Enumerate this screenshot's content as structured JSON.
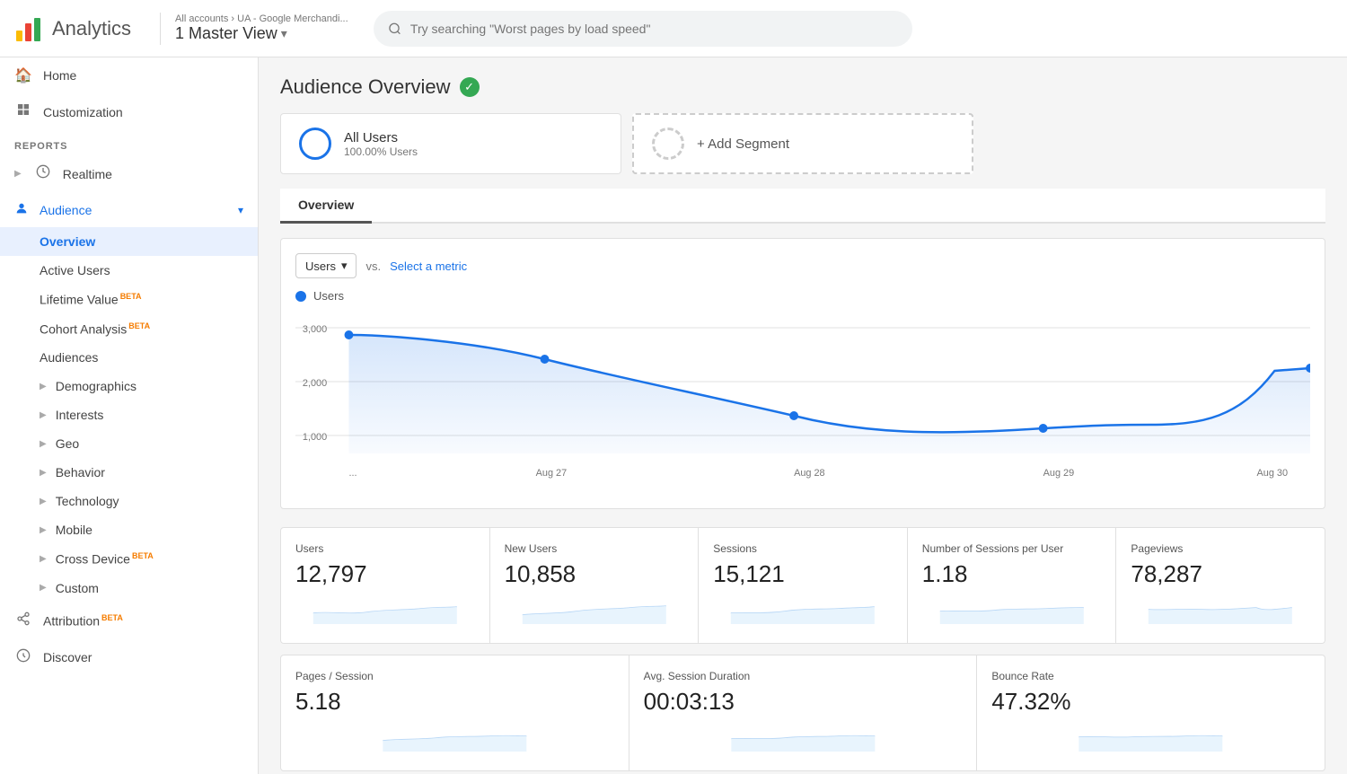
{
  "header": {
    "app_title": "Analytics",
    "breadcrumb": "All accounts › UA - Google Merchandi...",
    "view_name": "1 Master View",
    "search_placeholder": "Try searching \"Worst pages by load speed\""
  },
  "sidebar": {
    "nav_items": [
      {
        "id": "home",
        "label": "Home",
        "icon": "🏠"
      },
      {
        "id": "customization",
        "label": "Customization",
        "icon": "⊞"
      }
    ],
    "section_label": "REPORTS",
    "report_items": [
      {
        "id": "realtime",
        "label": "Realtime",
        "icon": "⏱",
        "expandable": true
      },
      {
        "id": "audience",
        "label": "Audience",
        "icon": "👤",
        "expandable": true,
        "expanded": true
      }
    ],
    "audience_sub": [
      {
        "id": "overview",
        "label": "Overview",
        "active": true
      },
      {
        "id": "active-users",
        "label": "Active Users"
      },
      {
        "id": "lifetime-value",
        "label": "Lifetime Value",
        "beta": true
      },
      {
        "id": "cohort-analysis",
        "label": "Cohort Analysis",
        "beta": true
      },
      {
        "id": "audiences",
        "label": "Audiences"
      },
      {
        "id": "demographics",
        "label": "Demographics",
        "expandable": true
      },
      {
        "id": "interests",
        "label": "Interests",
        "expandable": true
      },
      {
        "id": "geo",
        "label": "Geo",
        "expandable": true
      },
      {
        "id": "behavior",
        "label": "Behavior",
        "expandable": true
      },
      {
        "id": "technology",
        "label": "Technology",
        "expandable": true
      },
      {
        "id": "mobile",
        "label": "Mobile",
        "expandable": true
      },
      {
        "id": "cross-device",
        "label": "Cross Device",
        "beta": true,
        "expandable": true
      },
      {
        "id": "custom",
        "label": "Custom",
        "expandable": true
      }
    ],
    "bottom_items": [
      {
        "id": "attribution",
        "label": "Attribution",
        "beta": true,
        "icon": "🔗"
      },
      {
        "id": "discover",
        "label": "Discover",
        "icon": "💡"
      }
    ]
  },
  "content": {
    "page_title": "Audience Overview",
    "segment": {
      "name": "All Users",
      "sub": "100.00% Users"
    },
    "add_segment_label": "+ Add Segment",
    "tab_active": "Overview",
    "chart": {
      "metric_label": "Users",
      "vs_label": "vs.",
      "select_metric_label": "Select a metric",
      "legend_label": "Users",
      "y_labels": [
        "3,000",
        "2,000",
        "1,000"
      ],
      "x_labels": [
        "...",
        "Aug 27",
        "Aug 28",
        "Aug 29",
        "Aug 30"
      ]
    },
    "metrics_row1": [
      {
        "label": "Users",
        "value": "12,797"
      },
      {
        "label": "New Users",
        "value": "10,858"
      },
      {
        "label": "Sessions",
        "value": "15,121"
      },
      {
        "label": "Number of Sessions per User",
        "value": "1.18"
      },
      {
        "label": "Pageviews",
        "value": "78,287"
      }
    ],
    "metrics_row2": [
      {
        "label": "Pages / Session",
        "value": "5.18"
      },
      {
        "label": "Avg. Session Duration",
        "value": "00:03:13"
      },
      {
        "label": "Bounce Rate",
        "value": "47.32%"
      }
    ]
  }
}
